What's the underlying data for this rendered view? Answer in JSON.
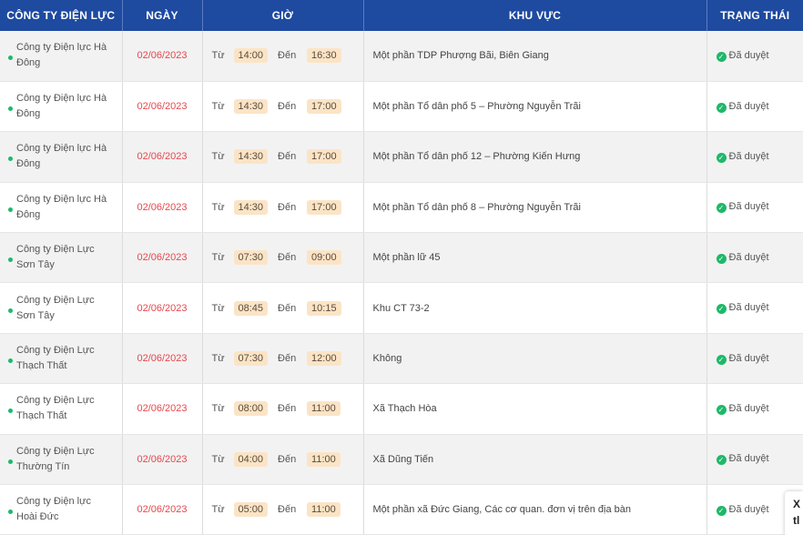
{
  "headers": {
    "company": "CÔNG TY ĐIỆN LỰC",
    "date": "NGÀY",
    "time": "GIỜ",
    "area": "KHU VỰC",
    "status": "TRẠNG THÁI"
  },
  "labels": {
    "from": "Từ",
    "to": "Đến"
  },
  "rows": [
    {
      "company": "Công ty Điện lực Hà Đông",
      "date": "02/06/2023",
      "from": "14:00",
      "to": "16:30",
      "area": "Một phần TDP Phượng Bãi, Biên Giang",
      "status": "Đã duyệt"
    },
    {
      "company": "Công ty Điện lực Hà Đông",
      "date": "02/06/2023",
      "from": "14:30",
      "to": "17:00",
      "area": "Một phần Tổ dân phố 5 – Phường Nguyễn Trãi",
      "status": "Đã duyệt"
    },
    {
      "company": "Công ty Điện lực Hà Đông",
      "date": "02/06/2023",
      "from": "14:30",
      "to": "17:00",
      "area": "Một phần Tổ dân phố 12 – Phường Kiến Hưng",
      "status": "Đã duyệt"
    },
    {
      "company": "Công ty Điện lực Hà Đông",
      "date": "02/06/2023",
      "from": "14:30",
      "to": "17:00",
      "area": "Một phần Tổ dân phố 8 – Phường Nguyễn Trãi",
      "status": "Đã duyệt"
    },
    {
      "company": "Công ty Điện Lực Sơn Tây",
      "date": "02/06/2023",
      "from": "07:30",
      "to": "09:00",
      "area": "Một phần lữ 45",
      "status": "Đã duyệt"
    },
    {
      "company": "Công ty Điện Lực Sơn Tây",
      "date": "02/06/2023",
      "from": "08:45",
      "to": "10:15",
      "area": "Khu CT 73-2",
      "status": "Đã duyệt"
    },
    {
      "company": "Công ty Điện Lực Thạch Thất",
      "date": "02/06/2023",
      "from": "07:30",
      "to": "12:00",
      "area": "Không",
      "status": "Đã duyệt"
    },
    {
      "company": "Công ty Điện Lực Thạch Thất",
      "date": "02/06/2023",
      "from": "08:00",
      "to": "11:00",
      "area": "Xã Thạch Hòa",
      "status": "Đã duyệt"
    },
    {
      "company": "Công ty Điện Lực Thường Tín",
      "date": "02/06/2023",
      "from": "04:00",
      "to": "11:00",
      "area": "Xã Dũng Tiến",
      "status": "Đã duyệt"
    },
    {
      "company": "Công ty Điện lực Hoài Đức",
      "date": "02/06/2023",
      "from": "05:00",
      "to": "11:00",
      "area": "Một phần xã Đức Giang, Các cơ quan. đơn vị trên địa bàn",
      "status": "Đã duyệt"
    }
  ],
  "side_tab": {
    "line1": "X",
    "line2": "tl"
  },
  "colors": {
    "header_bg": "#1e4aa0",
    "date_red": "#e5484d",
    "chip_bg": "#fbe4c6",
    "status_green": "#1fb86a"
  },
  "icons": {
    "status": "check-circle-icon",
    "company": "green-dot-icon"
  }
}
